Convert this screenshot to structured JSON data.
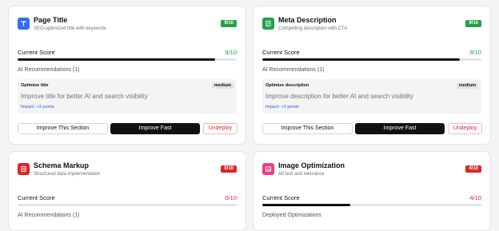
{
  "colors": {
    "green": "#22a048",
    "red": "#dc2626",
    "blue_icon": "#2f6ff0",
    "pink_icon": "#ea3f86",
    "dark": "#111111"
  },
  "cards": [
    {
      "icon": "text-type-icon",
      "title": "Page Title",
      "subtitle": "SEO-optimized title with keywords",
      "badge": "9/10",
      "score_label": "Current Score",
      "score_value": "9/10",
      "progress_fraction": 0.9,
      "rec_heading": "AI Recommendations (1)",
      "rec_name": "Optimize title",
      "rec_level": "medium",
      "rec_text": "Improve title for better AI and search visibility",
      "rec_impact": "Impact: +3 points",
      "btn_improve_section": "Improve This Section",
      "btn_improve_fast": "Improve Fast",
      "btn_undeploy": "Undeploy"
    },
    {
      "icon": "document-icon",
      "title": "Meta Description",
      "subtitle": "Compelling description with CTA",
      "badge": "9/10",
      "score_label": "Current Score",
      "score_value": "9/10",
      "progress_fraction": 0.9,
      "rec_heading": "AI Recommendations (1)",
      "rec_name": "Optimize description",
      "rec_level": "medium",
      "rec_text": "Improve description for better AI and search visibility",
      "rec_impact": "Impact: +3 points",
      "btn_improve_section": "Improve This Section",
      "btn_improve_fast": "Improve Fast",
      "btn_undeploy": "Undeploy"
    },
    {
      "icon": "database-icon",
      "title": "Schema Markup",
      "subtitle": "Structured data implementation",
      "badge": "0/10",
      "score_label": "Current Score",
      "score_value": "0/10",
      "progress_fraction": 0.0,
      "rec_heading": "AI Recommendations (1)"
    },
    {
      "icon": "image-icon",
      "title": "Image Optimization",
      "subtitle": "Alt text and relevance",
      "badge": "4/10",
      "score_label": "Current Score",
      "score_value": "4/10",
      "progress_fraction": 0.4,
      "rec_heading": "Deployed Optimizations"
    }
  ]
}
